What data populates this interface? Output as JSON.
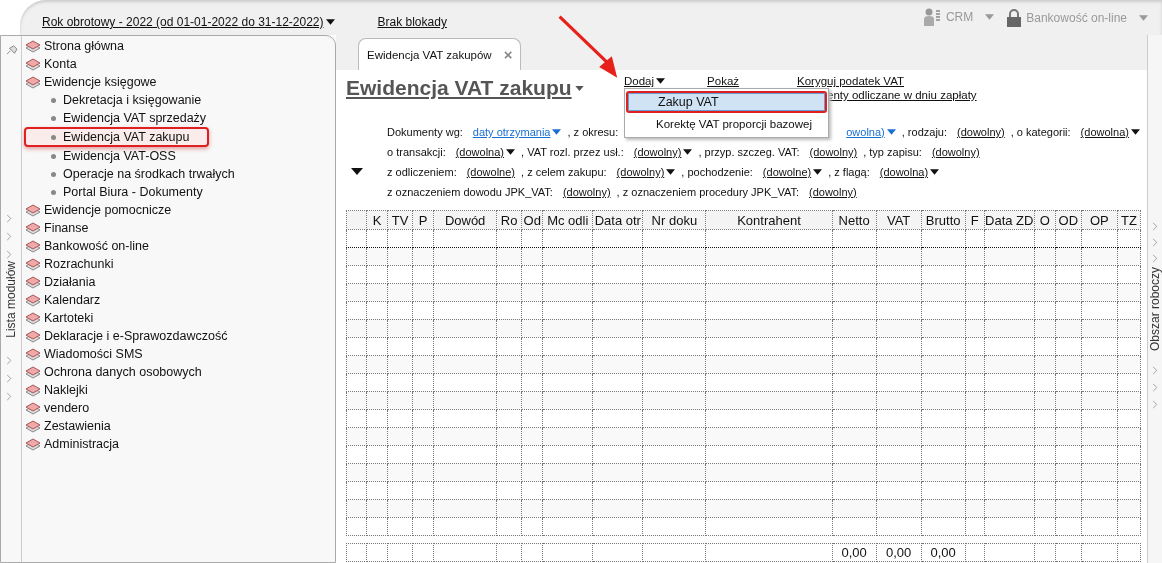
{
  "top_bar": {
    "year_selector": "Rok obrotowy - 2022  (od 01-01-2022 do 31-12-2022)",
    "lock_status": "Brak blokady",
    "crm": "CRM",
    "banking": "Bankowość on-line"
  },
  "sidebar": {
    "label": "Lista modułów",
    "items": [
      {
        "label": "Strona główna",
        "selected": false
      },
      {
        "label": "Konta",
        "selected": false
      },
      {
        "label": "Ewidencje księgowe",
        "selected": false,
        "children": [
          {
            "label": "Dekretacja i księgowanie",
            "selected": false
          },
          {
            "label": "Ewidencja VAT sprzedaży",
            "selected": false
          },
          {
            "label": "Ewidencja VAT zakupu",
            "selected": true
          },
          {
            "label": "Ewidencja VAT-OSS",
            "selected": false
          },
          {
            "label": "Operacje na środkach trwałych",
            "selected": false
          },
          {
            "label": "Portal Biura - Dokumenty",
            "selected": false
          }
        ]
      },
      {
        "label": "Ewidencje pomocnicze",
        "selected": false
      },
      {
        "label": "Finanse",
        "selected": false
      },
      {
        "label": "Bankowość on-line",
        "selected": false
      },
      {
        "label": "Rozrachunki",
        "selected": false
      },
      {
        "label": "Działania",
        "selected": false
      },
      {
        "label": "Kalendarz",
        "selected": false
      },
      {
        "label": "Kartoteki",
        "selected": false
      },
      {
        "label": "Deklaracje i e-Sprawozdawczość",
        "selected": false
      },
      {
        "label": "Wiadomości SMS",
        "selected": false
      },
      {
        "label": "Ochrona danych osobowych",
        "selected": false
      },
      {
        "label": "Naklejki",
        "selected": false
      },
      {
        "label": "vendero",
        "selected": false
      },
      {
        "label": "Zestawienia",
        "selected": false
      },
      {
        "label": "Administracja",
        "selected": false
      }
    ]
  },
  "tabs": [
    {
      "label": "Ewidencja VAT zakupów",
      "selected": true,
      "close": "×"
    }
  ],
  "page_title": "Ewidencja VAT zakupu",
  "actions": [
    {
      "label": "Dodaj",
      "kind": "menu"
    },
    {
      "label": "Pokaż",
      "kind": "link"
    },
    {
      "label": "Koryguj podatek VAT",
      "kind": "link"
    }
  ],
  "second_action": "enty odliczane w dniu zapłaty",
  "dropdown_menu": [
    {
      "label": "Zakup VAT",
      "selected": true
    },
    {
      "label": "Korektę VAT proporcji bazowej",
      "selected": false
    }
  ],
  "filters": [
    [
      {
        "kind": "label",
        "text": "Dokumenty wg:"
      },
      {
        "kind": "dropdown",
        "text": "daty otrzymania",
        "changed": true
      },
      {
        "kind": "label",
        "text": ", z okresu:"
      },
      {
        "kind": "cut-dropdown",
        "text": "owolna)",
        "changed": true
      },
      {
        "kind": "label",
        "text": ", rodzaju:"
      },
      {
        "kind": "link",
        "text": "(dowolny)",
        "changed": false
      },
      {
        "kind": "label",
        "text": ", o kategorii:"
      },
      {
        "kind": "dropdown",
        "text": "(dowolna)",
        "changed": false
      }
    ],
    [
      {
        "kind": "label",
        "text": "o transakcji:"
      },
      {
        "kind": "dropdown",
        "text": "(dowolna)",
        "changed": false
      },
      {
        "kind": "label",
        "text": ", VAT rozl. przez usł.:"
      },
      {
        "kind": "dropdown",
        "text": "(dowolny)",
        "changed": false
      },
      {
        "kind": "label",
        "text": ", przyp. szczeg. VAT:"
      },
      {
        "kind": "link",
        "text": "(dowolny)",
        "changed": false
      },
      {
        "kind": "label",
        "text": ", typ zapisu:"
      },
      {
        "kind": "link",
        "text": "(dowolny)",
        "changed": false
      }
    ],
    [
      {
        "kind": "label",
        "text": "z odliczeniem:"
      },
      {
        "kind": "link",
        "text": "(dowolne)",
        "changed": false
      },
      {
        "kind": "label",
        "text": ", z celem zakupu:"
      },
      {
        "kind": "dropdown",
        "text": "(dowolny)",
        "changed": false
      },
      {
        "kind": "label",
        "text": ", pochodzenie:"
      },
      {
        "kind": "dropdown",
        "text": "(dowolne)",
        "changed": false
      },
      {
        "kind": "label",
        "text": ", z flagą:"
      },
      {
        "kind": "dropdown",
        "text": "(dowolna)",
        "changed": false
      }
    ],
    [
      {
        "kind": "label",
        "text": "z oznaczeniem dowodu JPK_VAT:"
      },
      {
        "kind": "link",
        "text": "(dowolny)",
        "changed": false
      },
      {
        "kind": "label",
        "text": ", z oznaczeniem procedury JPK_VAT:"
      },
      {
        "kind": "link",
        "text": "(dowolny)",
        "changed": false
      }
    ]
  ],
  "table": {
    "columns": [
      {
        "label": "K"
      },
      {
        "label": "TV"
      },
      {
        "label": "P"
      },
      {
        "label": "Dowód"
      },
      {
        "label": "Ro"
      },
      {
        "label": "Od"
      },
      {
        "label": "Mc odli"
      },
      {
        "label": "Data otr"
      },
      {
        "label": "Nr doku"
      },
      {
        "label": "Kontrahent"
      },
      {
        "label": "Netto",
        "total": "0,00"
      },
      {
        "label": "VAT",
        "total": "0,00"
      },
      {
        "label": "Brutto",
        "total": "0,00"
      },
      {
        "label": "F"
      },
      {
        "label": "Data ZD"
      },
      {
        "label": "O"
      },
      {
        "label": "OD"
      },
      {
        "label": "OP"
      },
      {
        "label": "TZ"
      }
    ]
  },
  "right_rail": {
    "label": "Obszar roboczy"
  }
}
